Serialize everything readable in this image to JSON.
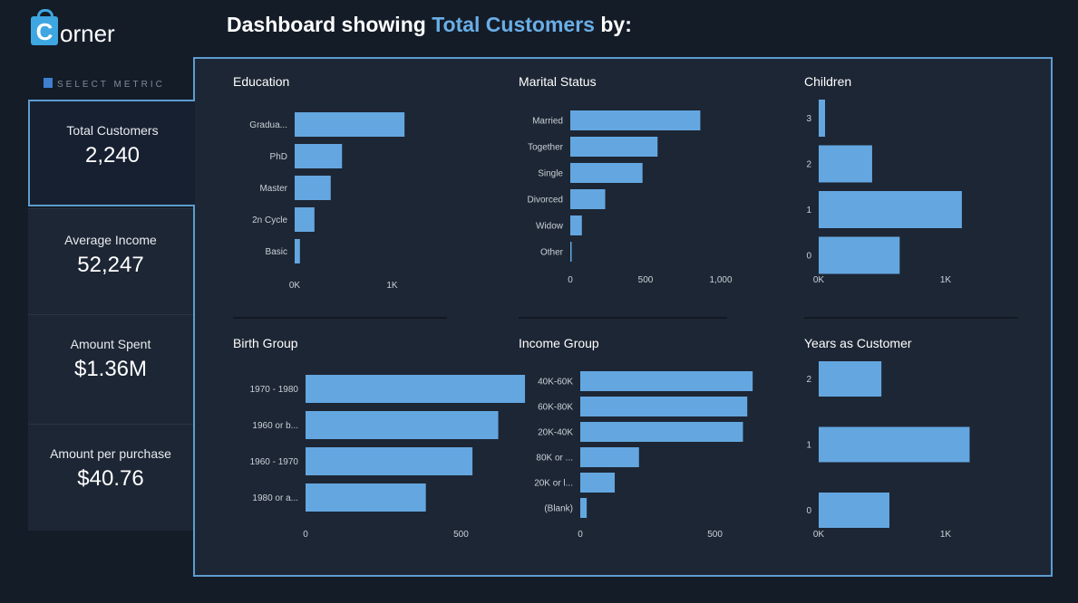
{
  "brand": {
    "logo_letter": "C",
    "logo_rest": "orner"
  },
  "header": {
    "title_prefix": "Dashboard showing ",
    "title_metric": "Total Customers",
    "title_suffix": " by:"
  },
  "sidebar": {
    "heading": "SELECT METRIC",
    "metrics": [
      {
        "label": "Total Customers",
        "value": "2,240",
        "active": true
      },
      {
        "label": "Average Income",
        "value": "52,247",
        "active": false
      },
      {
        "label": "Amount Spent",
        "value": "$1.36M",
        "active": false
      },
      {
        "label": "Amount per purchase",
        "value": "$40.76",
        "active": false
      }
    ]
  },
  "colors": {
    "bar": "#64a7e0",
    "accent": "#6aaee6",
    "border": "#5d9ccf"
  },
  "chart_data": [
    {
      "type": "bar",
      "orientation": "horizontal",
      "title": "Education",
      "categories": [
        "Gradua...",
        "PhD",
        "Master",
        "2n Cycle",
        "Basic"
      ],
      "values": [
        1127,
        486,
        370,
        203,
        54
      ],
      "xlim": [
        0,
        1200
      ],
      "ticks": [
        0,
        1000
      ],
      "tick_labels": [
        "0K",
        "1K"
      ]
    },
    {
      "type": "bar",
      "orientation": "horizontal",
      "title": "Marital Status",
      "categories": [
        "Married",
        "Together",
        "Single",
        "Divorced",
        "Widow",
        "Other"
      ],
      "values": [
        864,
        580,
        480,
        232,
        77,
        7
      ],
      "xlim": [
        0,
        1000
      ],
      "ticks": [
        0,
        500,
        1000
      ],
      "tick_labels": [
        "0",
        "500",
        "1,000"
      ]
    },
    {
      "type": "bar",
      "orientation": "horizontal",
      "title": "Children",
      "categories": [
        "3",
        "2",
        "1",
        "0"
      ],
      "values": [
        50,
        421,
        1128,
        638
      ],
      "xlim": [
        0,
        1200
      ],
      "ticks": [
        0,
        1000
      ],
      "tick_labels": [
        "0K",
        "1K"
      ]
    },
    {
      "type": "bar",
      "orientation": "horizontal",
      "title": "Birth Group",
      "categories": [
        "1970 - 1980",
        "1960 or b...",
        "1960 - 1970",
        "1980 or a..."
      ],
      "values": [
        706,
        620,
        537,
        387
      ],
      "xlim": [
        0,
        700
      ],
      "ticks": [
        0,
        500
      ],
      "tick_labels": [
        "0",
        "500"
      ]
    },
    {
      "type": "bar",
      "orientation": "horizontal",
      "title": "Income Group",
      "categories": [
        "40K-60K",
        "60K-80K",
        "20K-40K",
        "80K or ...",
        "20K or l...",
        "(Blank)"
      ],
      "values": [
        640,
        620,
        604,
        218,
        128,
        24
      ],
      "xlim": [
        0,
        700
      ],
      "ticks": [
        0,
        500
      ],
      "tick_labels": [
        "0",
        "500"
      ]
    },
    {
      "type": "bar",
      "orientation": "horizontal",
      "title": "Years as Customer",
      "categories": [
        "2",
        "1",
        "0"
      ],
      "values": [
        494,
        1189,
        557
      ],
      "xlim": [
        0,
        1200
      ],
      "ticks": [
        0,
        1000
      ],
      "tick_labels": [
        "0K",
        "1K"
      ]
    }
  ]
}
